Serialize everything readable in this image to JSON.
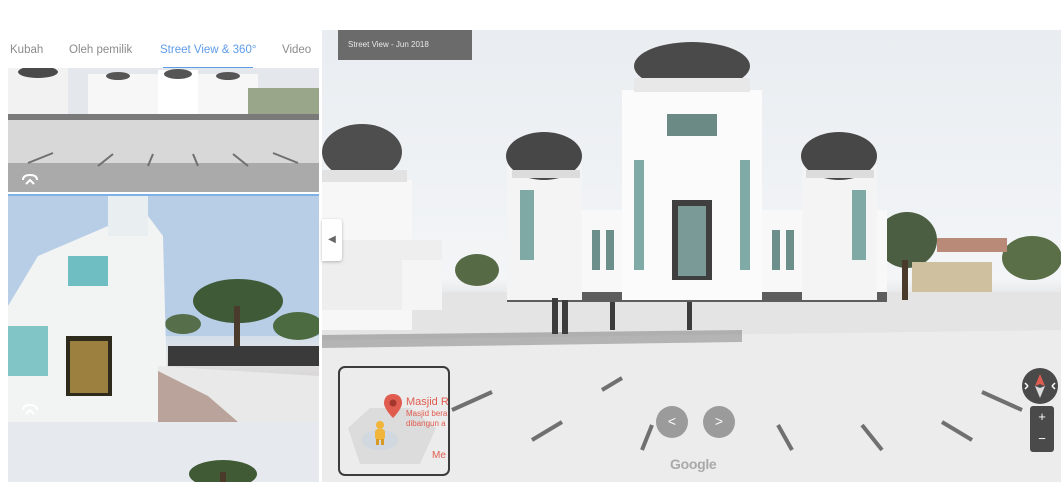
{
  "tabs": {
    "items": [
      {
        "label": "Kubah"
      },
      {
        "label": "Oleh pemilik"
      },
      {
        "label": "Street View & 360°"
      },
      {
        "label": "Video"
      }
    ],
    "active_index": 2
  },
  "thumbnails": [
    {
      "icon": "street-view-360-icon"
    },
    {
      "icon": "street-view-360-icon"
    },
    {
      "icon": ""
    }
  ],
  "viewer": {
    "date_label": "Street View - Jun 2018",
    "collapse_icon": "chevron-left-icon",
    "nav_left_icon": "chevron-left-icon",
    "nav_right_icon": "chevron-right-icon",
    "brand": "Google",
    "zoom_in": "+",
    "zoom_out": "−"
  },
  "minimap": {
    "place_title": "Masjid R",
    "place_desc_line1": "Masjid bera",
    "place_desc_line2": "dibangun a",
    "bottom_text": "Me"
  },
  "colors": {
    "accent": "#5f9ce8",
    "marker": "#e05c4f",
    "pegman": "#f1b53a"
  }
}
